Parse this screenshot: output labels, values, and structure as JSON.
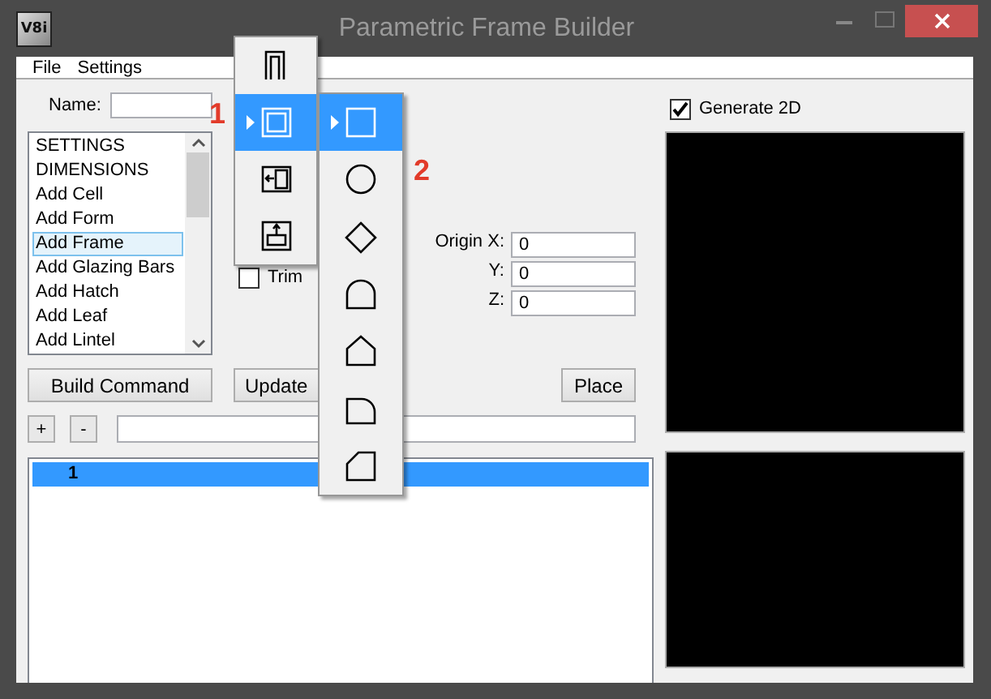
{
  "window": {
    "title": "Parametric Frame Builder",
    "icon_text": "V8i"
  },
  "menu": [
    "File",
    "Settings"
  ],
  "name_field": {
    "label": "Name:"
  },
  "command_list": {
    "items": [
      {
        "label": "SETTINGS",
        "selected": false
      },
      {
        "label": "DIMENSIONS",
        "selected": false
      },
      {
        "label": "Add Cell",
        "selected": false
      },
      {
        "label": "Add Form",
        "selected": false
      },
      {
        "label": "Add Frame",
        "selected": true
      },
      {
        "label": "Add Glazing Bars",
        "selected": false
      },
      {
        "label": "Add Hatch",
        "selected": false
      },
      {
        "label": "Add Leaf",
        "selected": false
      },
      {
        "label": "Add Lintel",
        "selected": false
      }
    ]
  },
  "trim": {
    "label": "Trim",
    "checked": false
  },
  "origin": [
    {
      "label": "Origin X:",
      "value": "0"
    },
    {
      "label": "Y:",
      "value": "0"
    },
    {
      "label": "Z:",
      "value": "0"
    }
  ],
  "buttons": [
    {
      "label": "Build Command",
      "kind": "left"
    },
    {
      "label": "Update",
      "kind": "left"
    },
    {
      "label": "Place",
      "kind": "right"
    }
  ],
  "step_buttons": [
    "+",
    "-"
  ],
  "steps": [
    {
      "label": "1",
      "selected": true
    }
  ],
  "generate_2d": {
    "label": "Generate 2D",
    "checked": true
  },
  "frame_menu": {
    "callout": "1",
    "items": [
      {
        "kind": "portal",
        "selected": false,
        "submenu": false
      },
      {
        "kind": "double-rect",
        "selected": true,
        "submenu": true
      },
      {
        "kind": "side-insert",
        "selected": false,
        "submenu": false
      },
      {
        "kind": "top-insert",
        "selected": false,
        "submenu": false
      }
    ]
  },
  "shape_menu": {
    "callout": "2",
    "items": [
      {
        "kind": "rect",
        "selected": true,
        "submenu": true
      },
      {
        "kind": "circle",
        "selected": false,
        "submenu": false
      },
      {
        "kind": "diamond",
        "selected": false,
        "submenu": false
      },
      {
        "kind": "arch",
        "selected": false,
        "submenu": false
      },
      {
        "kind": "gable",
        "selected": false,
        "submenu": false
      },
      {
        "kind": "quarter-arch",
        "selected": false,
        "submenu": false
      },
      {
        "kind": "chamfer",
        "selected": false,
        "submenu": false
      }
    ]
  }
}
